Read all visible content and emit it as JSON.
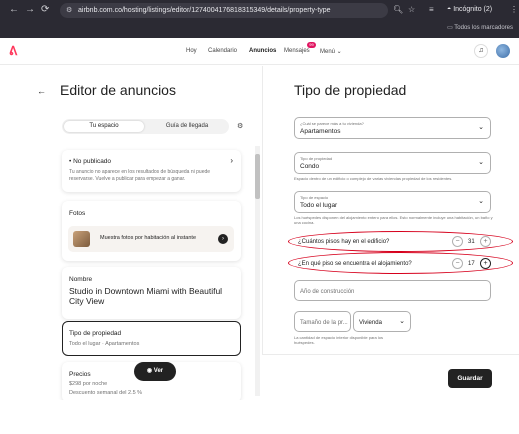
{
  "browser": {
    "url": "airbnb.com.co/hosting/listings/editor/1274004176818315349/details/property-type",
    "incognito_label": "Incógnito (2)",
    "bookmarks_label": "Todos los marcadores"
  },
  "topbar": {
    "nav_items": [
      "Hoy",
      "Calendario",
      "Anuncios",
      "Mensajes",
      "Menú"
    ],
    "active_item": "Anuncios",
    "messages_badge": "99"
  },
  "left": {
    "title": "Editor de anuncios",
    "tabs": [
      "Tu espacio",
      "Guía de llegada"
    ],
    "status_card": {
      "title": "No publicado",
      "text": "Tu anuncio no aparece en los resultados de búsqueda ni puede reservarse. Vuelve a publicar para empezar a ganar."
    },
    "photos_card": {
      "title": "Fotos",
      "row_text": "Muestra fotos por habitación al instante"
    },
    "name_card": {
      "label": "Nombre",
      "value": "Studio in Downtown Miami with Beautiful City View"
    },
    "type_card": {
      "label": "Tipo de propiedad",
      "value": "Todo el lugar · Apartamentos"
    },
    "prices_card": {
      "label": "Precios",
      "line1": "$298 por noche",
      "line2": "Descuento semanal del 2.5 %"
    },
    "ver_button": "Ver"
  },
  "right": {
    "title": "Tipo de propiedad",
    "field_category": {
      "label": "¿Cuál se parece más a tu vivienda?",
      "value": "Apartamentos"
    },
    "field_type": {
      "label": "Tipo de propiedad",
      "value": "Condo",
      "help": "Espacio dentro de un edificio o complejo de varias viviendas propiedad de los residentes."
    },
    "field_space": {
      "label": "Tipo de espacio",
      "value": "Todo el lugar",
      "help": "Los huéspedes disponen del alojamiento entero para ellos. Esto normalmente incluye una habitación, un baño y una cocina."
    },
    "floors": {
      "label": "¿Cuántos pisos hay en el edificio?",
      "value": "31"
    },
    "floor": {
      "label": "¿En qué piso se encuentra el alojamiento?",
      "value": "17"
    },
    "year_placeholder": "Año de construcción",
    "size_placeholder": "Tamaño de la pr...",
    "size_unit": "Vivienda",
    "size_help": "La cantidad de espacio interior disponible para los huéspedes.",
    "save_button": "Guardar"
  }
}
